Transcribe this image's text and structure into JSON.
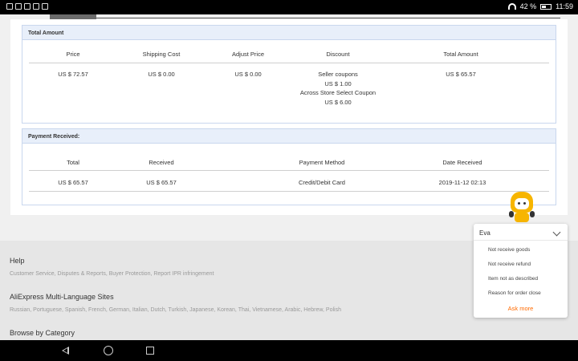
{
  "status_bar": {
    "battery": "42 %",
    "time": "11:59"
  },
  "total_amount": {
    "title": "Total Amount",
    "headers": [
      "Price",
      "Shipping Cost",
      "Adjust Price",
      "Discount",
      "Total Amount"
    ],
    "price": "US $ 72.57",
    "shipping": "US $ 0.00",
    "adjust": "US $ 0.00",
    "discount_lines": [
      "Seller coupons",
      "US $ 1.00",
      "Across Store Select Coupon",
      "US $ 6.00"
    ],
    "total": "US $ 65.57"
  },
  "payment": {
    "title": "Payment Received:",
    "headers": [
      "Total",
      "Received",
      "Payment Method",
      "Date Received"
    ],
    "total": "US $ 65.57",
    "received": "US $ 65.57",
    "method": "Credit/Debit Card",
    "date": "2019-11-12 02:13"
  },
  "footer": {
    "help_title": "Help",
    "help_links": "Customer Service, Disputes & Reports, Buyer Protection, Report IPR infringement",
    "multilang_title": "AliExpress Multi-Language Sites",
    "multilang_links": "Russian, Portuguese, Spanish, French, German, Italian, Dutch, Turkish, Japanese, Korean, Thai, Vietnamese, Arabic, Hebrew, Polish",
    "browse_title": "Browse by Category"
  },
  "chat": {
    "name": "Eva",
    "options": [
      "Not receive goods",
      "Not receive refund",
      "Item not as described",
      "Reason for order close"
    ],
    "more": "Ask more"
  },
  "icons": {
    "back": "back-icon",
    "home": "home-icon",
    "recent": "recent-apps-icon",
    "chevron": "chevron-down-icon"
  },
  "colors": {
    "accent": "#ff6a00",
    "panel_header": "#e8effa",
    "panel_border": "#c9d7ee"
  }
}
